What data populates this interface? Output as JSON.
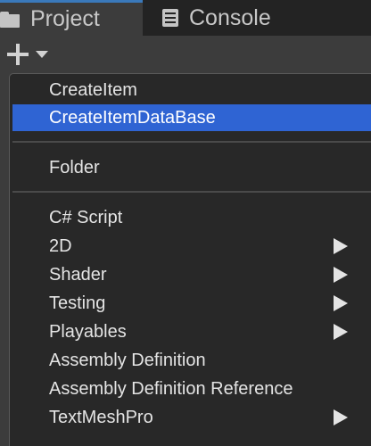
{
  "tabs": [
    {
      "label": "Project",
      "icon": "folder-icon",
      "active": true
    },
    {
      "label": "Console",
      "icon": "console-icon",
      "active": false
    }
  ],
  "toolbar": {
    "add_icon": "plus-icon",
    "dropdown_icon": "caret-down-icon"
  },
  "menu": {
    "highlight_color": "#2f64d3",
    "groups": [
      {
        "items": [
          {
            "label": "CreateItem",
            "submenu": false
          },
          {
            "label": "CreateItemDataBase",
            "submenu": false,
            "highlighted": true
          }
        ]
      },
      {
        "items": [
          {
            "label": "Folder",
            "submenu": false
          }
        ]
      },
      {
        "items": [
          {
            "label": "C# Script",
            "submenu": false
          },
          {
            "label": "2D",
            "submenu": true
          },
          {
            "label": "Shader",
            "submenu": true
          },
          {
            "label": "Testing",
            "submenu": true
          },
          {
            "label": "Playables",
            "submenu": true
          },
          {
            "label": "Assembly Definition",
            "submenu": false
          },
          {
            "label": "Assembly Definition Reference",
            "submenu": false
          },
          {
            "label": "TextMeshPro",
            "submenu": true
          }
        ]
      }
    ]
  }
}
